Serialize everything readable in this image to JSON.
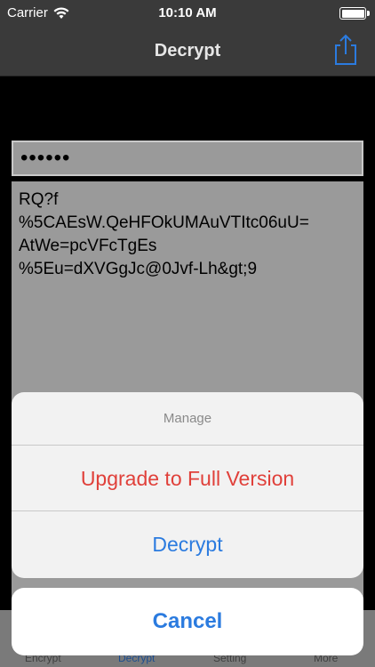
{
  "status": {
    "carrier": "Carrier",
    "time": "10:10 AM"
  },
  "nav": {
    "title": "Decrypt",
    "share_icon": "share-icon"
  },
  "password": {
    "value": "••••••"
  },
  "ciphertext": {
    "lines": [
      "RQ?f",
      "%5CAEsW.QeHFOkUMAuVTItc06uU=",
      "AtWe=pcVFcTgEs",
      "%5Eu=dXVGgJc@0Jvf-Lh&gt;9"
    ]
  },
  "tabs": [
    {
      "label": "Encrypt"
    },
    {
      "label": "Decrypt"
    },
    {
      "label": "Setting"
    },
    {
      "label": "More"
    }
  ],
  "sheet": {
    "title": "Manage",
    "upgrade_label": "Upgrade to Full Version",
    "decrypt_label": "Decrypt",
    "cancel_label": "Cancel"
  },
  "colors": {
    "accent": "#2b7bdf",
    "destructive": "#e0403a"
  }
}
